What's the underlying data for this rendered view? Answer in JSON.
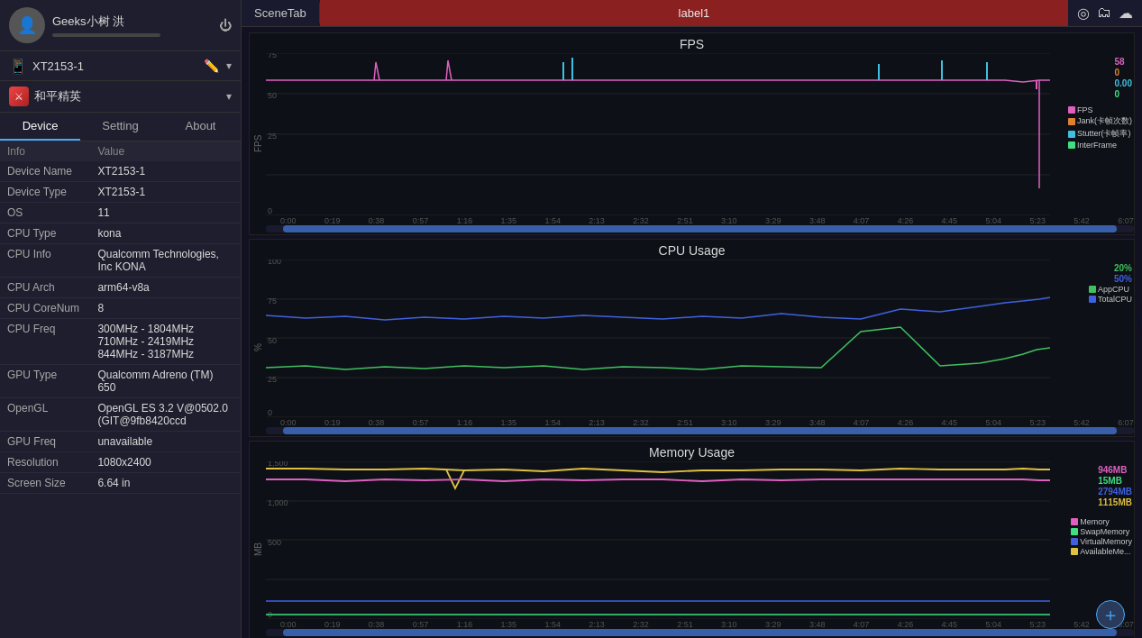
{
  "sidebar": {
    "username": "Geeks小树 洪",
    "device_tab": "XT2153-1",
    "app_tab": "和平精英",
    "tabs": [
      {
        "id": "device",
        "label": "Device"
      },
      {
        "id": "setting",
        "label": "Setting"
      },
      {
        "id": "about",
        "label": "About"
      }
    ],
    "active_tab": "device",
    "table_header": {
      "col_info": "Info",
      "col_value": "Value"
    },
    "table_rows": [
      {
        "info": "Device Name",
        "value": "XT2153-1"
      },
      {
        "info": "Device Type",
        "value": "XT2153-1"
      },
      {
        "info": "OS",
        "value": "11"
      },
      {
        "info": "CPU Type",
        "value": "kona"
      },
      {
        "info": "CPU Info",
        "value": "Qualcomm Technologies, Inc KONA"
      },
      {
        "info": "CPU Arch",
        "value": "arm64-v8a"
      },
      {
        "info": "CPU CoreNum",
        "value": "8"
      },
      {
        "info": "CPU Freq",
        "value": "300MHz - 1804MHz\n710MHz - 2419MHz\n844MHz - 3187MHz"
      },
      {
        "info": "GPU Type",
        "value": "Qualcomm Adreno (TM) 650"
      },
      {
        "info": "OpenGL",
        "value": "OpenGL ES 3.2 V@0502.0 (GIT@9fb8420ccd"
      },
      {
        "info": "GPU Freq",
        "value": "unavailable"
      },
      {
        "info": "Resolution",
        "value": "1080x2400"
      },
      {
        "info": "Screen Size",
        "value": "6.64 in"
      }
    ]
  },
  "topbar": {
    "scene_tab": "SceneTab",
    "label": "label1"
  },
  "charts": {
    "fps": {
      "title": "FPS",
      "y_label": "FPS",
      "values": {
        "val1": "58",
        "val2": "0",
        "val3": "0.00",
        "val4": "0"
      },
      "legend": [
        {
          "label": "FPS",
          "color": "#e060c0"
        },
        {
          "label": "Jank(卡帧次数)",
          "color": "#e08030"
        },
        {
          "label": "Stutter(卡帧率)",
          "color": "#40c0e0"
        },
        {
          "label": "InterFrame",
          "color": "#40e080"
        }
      ],
      "x_labels": [
        "0:00",
        "0:19",
        "0:38",
        "0:57",
        "1:16",
        "1:35",
        "1:54",
        "2:13",
        "2:32",
        "2:51",
        "3:10",
        "3:29",
        "3:48",
        "4:07",
        "4:26",
        "4:45",
        "5:04",
        "5:23",
        "5:42",
        "6:07"
      ]
    },
    "cpu": {
      "title": "CPU Usage",
      "y_label": "%",
      "values": {
        "val1": "20%",
        "val2": "50%"
      },
      "legend": [
        {
          "label": "AppCPU",
          "color": "#40c060"
        },
        {
          "label": "TotalCPU",
          "color": "#4060e0"
        }
      ],
      "x_labels": [
        "0:00",
        "0:19",
        "0:38",
        "0:57",
        "1:16",
        "1:35",
        "1:54",
        "2:13",
        "2:32",
        "2:51",
        "3:10",
        "3:29",
        "3:48",
        "4:07",
        "4:26",
        "4:45",
        "5:04",
        "5:23",
        "5:42",
        "6:07"
      ]
    },
    "memory": {
      "title": "Memory Usage",
      "y_label": "MB",
      "values": {
        "val1": "946MB",
        "val2": "15MB",
        "val3": "2794MB",
        "val4": "1115MB"
      },
      "legend": [
        {
          "label": "Memory",
          "color": "#e060c0"
        },
        {
          "label": "SwapMemory",
          "color": "#40e080"
        },
        {
          "label": "VirtualMemory",
          "color": "#4060e0"
        },
        {
          "label": "AvailableMe...",
          "color": "#e0c040"
        }
      ],
      "x_labels": [
        "0:00",
        "0:19",
        "0:38",
        "0:57",
        "1:16",
        "1:35",
        "1:54",
        "2:13",
        "2:32",
        "2:51",
        "3:10",
        "3:29",
        "3:48",
        "4:07",
        "4:26",
        "4:45",
        "5:04",
        "5:23",
        "5:42",
        "6:07"
      ]
    }
  }
}
